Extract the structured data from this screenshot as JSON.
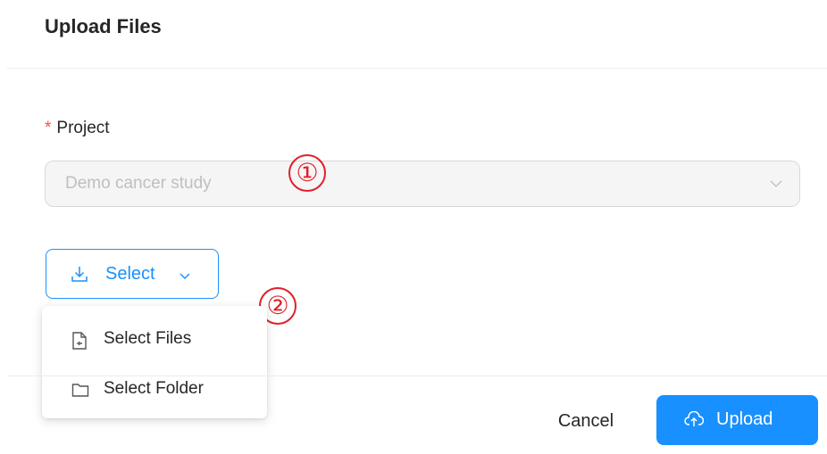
{
  "dialog": {
    "title": "Upload Files"
  },
  "form": {
    "project_label": "Project",
    "required_mark": "*",
    "project_value": "Demo cancer study"
  },
  "select_button": {
    "label": "Select",
    "icon": "download-icon",
    "chevron": "chevron-down-icon"
  },
  "select_menu": {
    "items": [
      {
        "label": "Select Files",
        "icon": "file-icon"
      },
      {
        "label": "Select Folder",
        "icon": "folder-icon"
      }
    ]
  },
  "annotations": {
    "marker_1": "①",
    "marker_2": "②",
    "color": "#e0202a"
  },
  "footer": {
    "cancel_label": "Cancel",
    "upload_label": "Upload",
    "upload_icon": "cloud-upload-icon"
  },
  "colors": {
    "primary": "#1890ff",
    "required": "#ff4d4f"
  }
}
